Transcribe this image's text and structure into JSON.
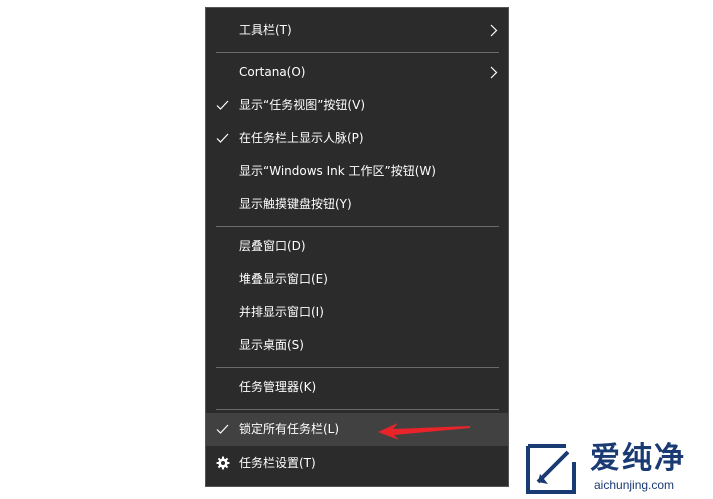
{
  "menu": {
    "items": [
      {
        "label": "工具栏(T)",
        "checked": false,
        "submenu": true
      },
      {
        "label": "Cortana(O)",
        "checked": false,
        "submenu": true
      },
      {
        "label": "显示“任务视图”按钮(V)",
        "checked": true
      },
      {
        "label": "在任务栏上显示人脉(P)",
        "checked": true
      },
      {
        "label": "显示“Windows Ink 工作区”按钮(W)",
        "checked": false
      },
      {
        "label": "显示触摸键盘按钮(Y)",
        "checked": false
      },
      {
        "label": "层叠窗口(D)",
        "checked": false
      },
      {
        "label": "堆叠显示窗口(E)",
        "checked": false
      },
      {
        "label": "并排显示窗口(I)",
        "checked": false
      },
      {
        "label": "显示桌面(S)",
        "checked": false
      },
      {
        "label": "任务管理器(K)",
        "checked": false
      },
      {
        "label": "锁定所有任务栏(L)",
        "checked": true,
        "highlighted": true
      },
      {
        "label": "任务栏设置(T)",
        "icon": "gear-icon"
      }
    ]
  },
  "colors": {
    "menu_background": "#2b2b2b",
    "highlight": "#414141",
    "separator": "#6a6a6a",
    "annotation_arrow": "#e8232a",
    "logo": "#1a3a73"
  },
  "watermark": {
    "title": "爱纯净",
    "url": "aichunjing.com"
  }
}
